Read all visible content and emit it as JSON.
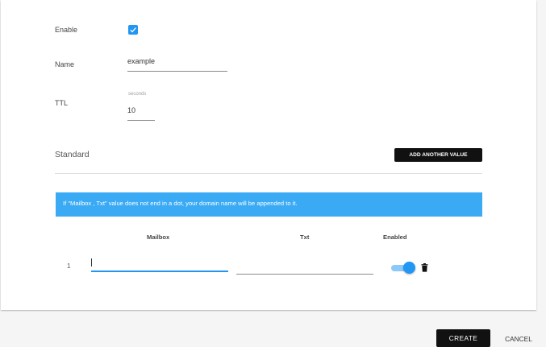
{
  "form": {
    "enable_label": "Enable",
    "enable_checked": true,
    "name_label": "Name",
    "name_value": "example",
    "ttl_label": "TTL",
    "ttl_helper": "seconds",
    "ttl_value": "10"
  },
  "section": {
    "title": "Standard",
    "add_button_label": "ADD ANOTHER VALUE"
  },
  "info_banner": {
    "text": "If \"Mailbox , Txt\" value does not end in a dot, your domain name will be appended to it."
  },
  "table": {
    "columns": [
      "Mailbox",
      "Txt",
      "Enabled"
    ],
    "rows": [
      {
        "index": "1",
        "mailbox": "",
        "txt": "",
        "enabled": true
      }
    ]
  },
  "actions": {
    "create_label": "CREATE",
    "cancel_label": "CANCEL"
  },
  "colors": {
    "accent": "#2196f3",
    "info_bg": "#3aaaf5",
    "dark_button": "#111111"
  },
  "icons": [
    "check-icon",
    "trash-icon"
  ]
}
